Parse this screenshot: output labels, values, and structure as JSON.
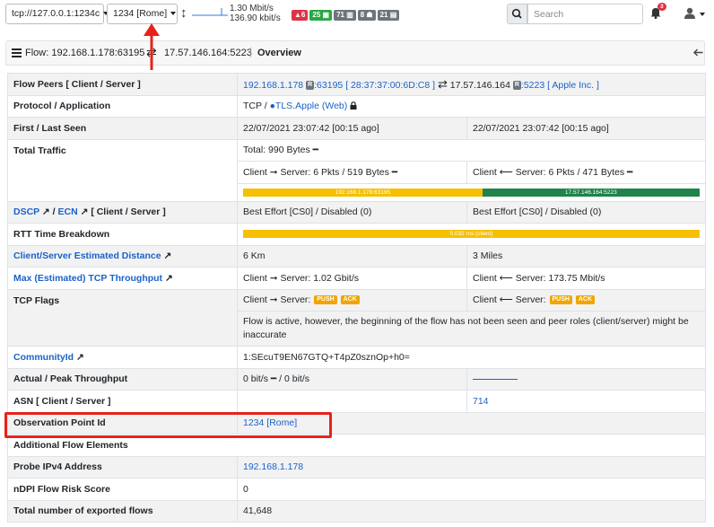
{
  "topbar": {
    "interface_label": "tcp://127.0.0.1:1234c",
    "observation_label": "1234 [Rome]",
    "throughput_up": "1.30 Mbit/s",
    "throughput_down": "136.90 kbit/s",
    "badges": [
      "6",
      "25",
      "71",
      "8",
      "21"
    ],
    "search_placeholder": "Search",
    "alerts_count": "3"
  },
  "header": {
    "prefix": "Flow:",
    "client": "192.168.1.178:63195",
    "server": "17.57.146.164:5223",
    "separator": "|",
    "tab": "Overview"
  },
  "rows": {
    "flow_peers": {
      "label": "Flow Peers [ Client / Server ]",
      "client_ip": "192.168.1.178",
      "client_port_tag": "R",
      "client_port": ":63195",
      "client_mac": "[ 28:37:37:00:6D:C8 ]",
      "server_ip": "17.57.146.164",
      "server_port_tag": "R",
      "server_port": ":5223",
      "server_vendor": "[ Apple Inc. ]"
    },
    "protocol": {
      "label": "Protocol / Application",
      "l4": "TCP /",
      "app": "TLS.Apple",
      "category": "(Web)"
    },
    "seen": {
      "label": "First / Last Seen",
      "first": "22/07/2021 23:07:42 [00:15 ago]",
      "last": "22/07/2021 23:07:42 [00:15 ago]"
    },
    "traffic": {
      "label": "Total Traffic",
      "total": "Total: 990 Bytes",
      "c2s": "Client ➞ Server: 6 Pkts / 519 Bytes",
      "s2c": "Client ⟵ Server: 6 Pkts / 471 Bytes",
      "bar_client": "192.168.1.178:63195",
      "bar_server": "17.57.146.164:5223",
      "client_share": 0.524
    },
    "dscp": {
      "label_dscp": "DSCP",
      "label_sep": "/",
      "label_ecn": "ECN",
      "label_suffix": "[ Client / Server ]",
      "client": "Best Effort [CS0] / Disabled (0)",
      "server": "Best Effort [CS0] / Disabled (0)"
    },
    "rtt": {
      "label": "RTT Time Breakdown",
      "bar": "0.032 ms (client)"
    },
    "distance": {
      "label": "Client/Server Estimated Distance",
      "client": "6 Km",
      "server": "3 Miles"
    },
    "tcp_throughput": {
      "label": "Max (Estimated) TCP Throughput",
      "client": "Client ➞ Server: 1.02 Gbit/s",
      "server": "Client ⟵ Server: 173.75 Mbit/s"
    },
    "tcp_flags": {
      "label": "TCP Flags",
      "client_prefix": "Client ➞ Server:",
      "server_prefix": "Client ⟵ Server:",
      "flags": [
        "PUSH",
        "ACK"
      ],
      "note": "Flow is active, however, the beginning of the flow has not been seen and peer roles (client/server) might be inaccurate"
    },
    "community": {
      "label": "CommunityId",
      "value": "1:SEcuT9EN67GTQ+T4pZ0sznOp+h0="
    },
    "throughput": {
      "label": "Actual / Peak Throughput",
      "value": "0 bit/s ━ / 0 bit/s"
    },
    "asn": {
      "label": "ASN [ Client / Server ]",
      "server": "714"
    },
    "observation": {
      "label": "Observation Point Id",
      "value": "1234 [Rome]"
    },
    "additional": {
      "label": "Additional Flow Elements"
    },
    "probe": {
      "label": "Probe IPv4 Address",
      "value": "192.168.1.178"
    },
    "risk": {
      "label": "nDPI Flow Risk Score",
      "value": "0"
    },
    "exported": {
      "label": "Total number of exported flows",
      "value": "41,648"
    }
  },
  "colors": {
    "link": "#1a62c9",
    "bar_client": "#f6c000",
    "bar_server": "#1e8449",
    "annotation": "#e8221b"
  }
}
